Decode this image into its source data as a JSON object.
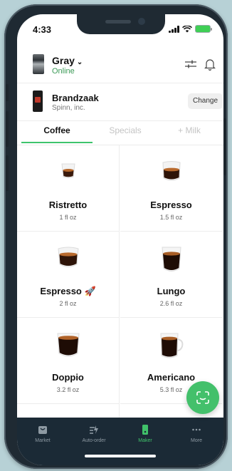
{
  "status_bar": {
    "time": "4:33"
  },
  "machine": {
    "name": "Gray",
    "status": "Online"
  },
  "roaster": {
    "name": "Brandzaak",
    "company": "Spinn, inc.",
    "change_label": "Change"
  },
  "tabs": [
    {
      "label": "Coffee",
      "active": true
    },
    {
      "label": "Specials",
      "active": false
    },
    {
      "label": "+ Milk",
      "active": false
    }
  ],
  "drinks": [
    {
      "name": "Ristretto",
      "volume": "1 fl oz"
    },
    {
      "name": "Espresso",
      "volume": "1.5 fl oz"
    },
    {
      "name": "Espresso 🚀",
      "volume": "2 fl oz"
    },
    {
      "name": "Lungo",
      "volume": "2.6 fl oz"
    },
    {
      "name": "Doppio",
      "volume": "3.2 fl oz"
    },
    {
      "name": "Americano",
      "volume": "5.3 fl oz"
    }
  ],
  "bottom_nav": [
    {
      "label": "Market",
      "icon": "bag-icon",
      "active": false
    },
    {
      "label": "Auto-order",
      "icon": "auto-order-icon",
      "active": false
    },
    {
      "label": "Maker",
      "icon": "maker-icon",
      "active": true
    },
    {
      "label": "More",
      "icon": "more-icon",
      "active": false
    }
  ],
  "colors": {
    "accent": "#43c06b",
    "nav_bg": "#1b2a36",
    "online": "#3a9a56",
    "background": "#b7d1d6"
  }
}
